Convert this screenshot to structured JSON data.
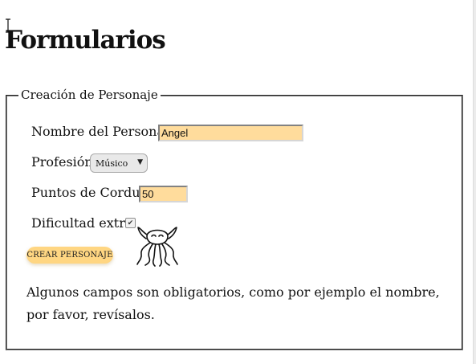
{
  "page": {
    "title": "Formularios"
  },
  "form": {
    "legend": "Creación de Personaje",
    "name_label": "Nombre del Personaje",
    "name_value": "Angel",
    "profession_label": "Profesión",
    "profession_value": "Músico",
    "sanity_label": "Puntos de Cordura",
    "sanity_value": "50",
    "difficulty_label": "Dificultad extra",
    "difficulty_checked": true,
    "submit_label": "CREAR PERSONAJE",
    "mascot_icon": "cthulhu-icon",
    "error_message": "Algunos campos son obligatorios, como por ejemplo el nombre, por favor, revísalos."
  },
  "colors": {
    "input_bg": "#ffdc9c",
    "button_bg": "#ffd682",
    "border": "#7a7a7a"
  }
}
